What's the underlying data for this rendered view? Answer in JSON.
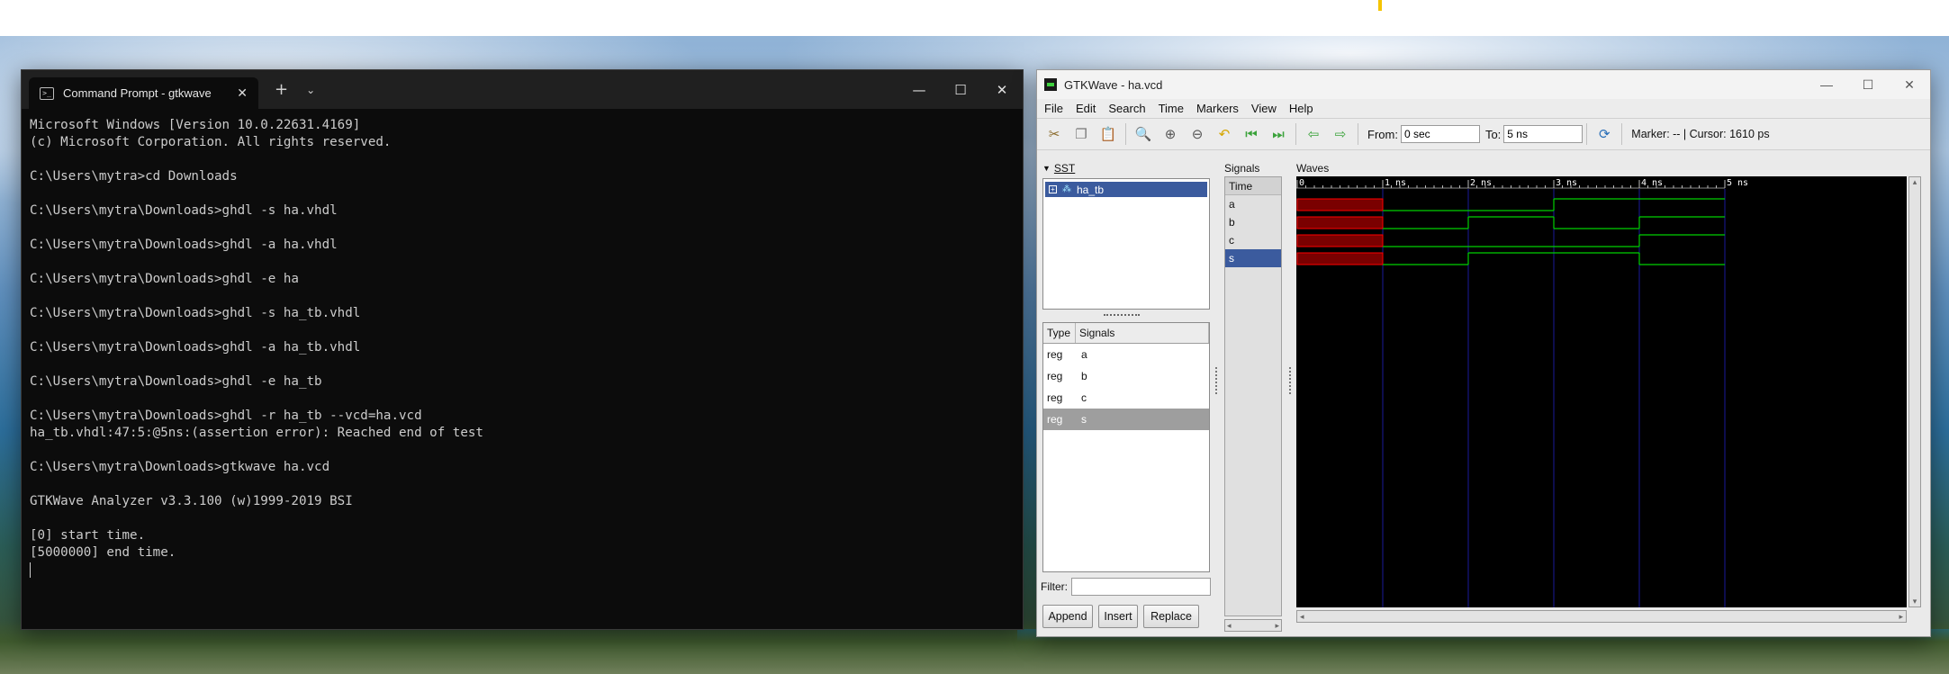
{
  "colors": {
    "terminal_bg": "#0c0c0c",
    "terminal_text": "#cccccc",
    "wave_high_low": "#00d000",
    "wave_undefined": "#ff0000",
    "wave_grid": "#1a1a9a",
    "selection_blue": "#3b5b9e"
  },
  "terminal": {
    "tab_title": "Command Prompt - gtkwave",
    "tab_icon": "terminal-icon",
    "lines": [
      "Microsoft Windows [Version 10.0.22631.4169]",
      "(c) Microsoft Corporation. All rights reserved.",
      "",
      "C:\\Users\\mytra>cd Downloads",
      "",
      "C:\\Users\\mytra\\Downloads>ghdl -s ha.vhdl",
      "",
      "C:\\Users\\mytra\\Downloads>ghdl -a ha.vhdl",
      "",
      "C:\\Users\\mytra\\Downloads>ghdl -e ha",
      "",
      "C:\\Users\\mytra\\Downloads>ghdl -s ha_tb.vhdl",
      "",
      "C:\\Users\\mytra\\Downloads>ghdl -a ha_tb.vhdl",
      "",
      "C:\\Users\\mytra\\Downloads>ghdl -e ha_tb",
      "",
      "C:\\Users\\mytra\\Downloads>ghdl -r ha_tb --vcd=ha.vcd",
      "ha_tb.vhdl:47:5:@5ns:(assertion error): Reached end of test",
      "",
      "C:\\Users\\mytra\\Downloads>gtkwave ha.vcd",
      "",
      "GTKWave Analyzer v3.3.100 (w)1999-2019 BSI",
      "",
      "[0] start time.",
      "[5000000] end time."
    ]
  },
  "gtkwave": {
    "title": "GTKWave - ha.vcd",
    "menu": [
      "File",
      "Edit",
      "Search",
      "Time",
      "Markers",
      "View",
      "Help"
    ],
    "toolbar": {
      "from_label": "From:",
      "from_value": "0 sec",
      "to_label": "To:",
      "to_value": "5 ns",
      "marker_text": "Marker: --  |  Cursor: 1610 ps"
    },
    "sst": {
      "label": "SST",
      "tree_item": "ha_tb"
    },
    "signal_table": {
      "headers": [
        "Type",
        "Signals"
      ],
      "rows": [
        {
          "type": "reg",
          "name": "a"
        },
        {
          "type": "reg",
          "name": "b"
        },
        {
          "type": "reg",
          "name": "c"
        },
        {
          "type": "reg",
          "name": "s"
        }
      ]
    },
    "filter_label": "Filter:",
    "buttons": {
      "append": "Append",
      "insert": "Insert",
      "replace": "Replace"
    },
    "signals_panel": {
      "label": "Signals",
      "time_label": "Time",
      "names": [
        "a",
        "b",
        "c",
        "s"
      ],
      "selected": "s"
    },
    "waves_panel": {
      "label": "Waves",
      "time_ticks": [
        "0",
        "1 ns",
        "2 ns",
        "3 ns",
        "4 ns",
        "5 ns"
      ],
      "time_end_ns": 5,
      "undefined_until_ns": 1,
      "signals": [
        {
          "name": "a",
          "transitions": [
            [
              1,
              0
            ],
            [
              2,
              0
            ],
            [
              3,
              1
            ],
            [
              4,
              1
            ],
            [
              5,
              1
            ]
          ]
        },
        {
          "name": "b",
          "transitions": [
            [
              1,
              0
            ],
            [
              2,
              1
            ],
            [
              3,
              0
            ],
            [
              4,
              1
            ],
            [
              5,
              1
            ]
          ]
        },
        {
          "name": "c",
          "transitions": [
            [
              1,
              0
            ],
            [
              2,
              0
            ],
            [
              3,
              0
            ],
            [
              4,
              1
            ],
            [
              5,
              1
            ]
          ]
        },
        {
          "name": "s",
          "transitions": [
            [
              1,
              0
            ],
            [
              2,
              1
            ],
            [
              3,
              1
            ],
            [
              4,
              0
            ],
            [
              5,
              0
            ]
          ]
        }
      ]
    }
  }
}
